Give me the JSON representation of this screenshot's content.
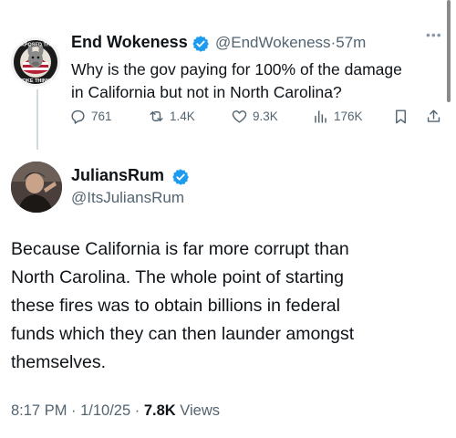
{
  "quoted_post": {
    "author_name": "End Wokeness",
    "author_handle": "@EndWokeness",
    "separator": "·",
    "time_ago": "57m",
    "more_label": "•••",
    "text_line1": "Why is the gov paying for 100% of the damage",
    "text_line2": "in California but not in North Carolina?",
    "replies": "761",
    "reposts": "1.4K",
    "likes": "9.3K",
    "views": "176K",
    "avatar_badge_top": "EXPOSED THE",
    "avatar_badge_bottom": "WOKE THINKS"
  },
  "reply_post": {
    "author_name": "JuliansRum",
    "author_handle": "@ItsJuliansRum",
    "text_lines": [
      "Because California is far more corrupt than",
      "North Carolina. The whole point of starting",
      "these fires was to obtain billions in federal",
      "funds which they can then launder amongst",
      "themselves."
    ],
    "time": "8:17 PM · 1/10/25 · ",
    "view_count": "7.8K",
    "views_label": " Views"
  },
  "colors": {
    "verified_blue": "#1d9bf0",
    "muted_text": "#536471",
    "primary_text": "#0f1419"
  }
}
